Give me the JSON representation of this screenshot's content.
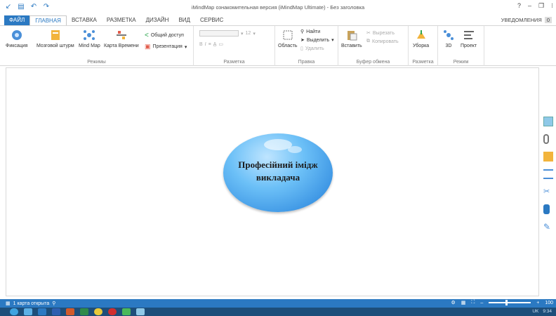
{
  "window": {
    "title": "iMindMap ознакомительная версия (iMindMap Ultimate) - Без заголовка"
  },
  "menu_tabs": [
    {
      "label": "ФАЙЛ"
    },
    {
      "label": "ГЛАВНАЯ"
    },
    {
      "label": "ВСТАВКА"
    },
    {
      "label": "РАЗМЕТКА"
    },
    {
      "label": "ДИЗАЙН"
    },
    {
      "label": "ВИД"
    },
    {
      "label": "СЕРВИС"
    }
  ],
  "notifications": {
    "label": "УВЕДОМЛЕНИЯ",
    "count": "0"
  },
  "ribbon": {
    "modes": {
      "label": "Режимы",
      "buttons": [
        "Фиксация",
        "Мозговой штурм",
        "Mind Map",
        "Карта Времени"
      ],
      "share": "Общий доступ",
      "presentation": "Презентация"
    },
    "layout": {
      "label": "Разметка",
      "font_size": "12"
    },
    "edit": {
      "label": "Правка",
      "area": "Область",
      "find": "Найти",
      "select": "Выделить",
      "delete": "Удалить"
    },
    "clipboard": {
      "label": "Буфер обмена",
      "paste": "Вставить",
      "cut": "Вырезать",
      "copy": "Копировать"
    },
    "layout2": {
      "label": "Разметка",
      "tidy": "Уборка"
    },
    "mode": {
      "label": "Режим",
      "three_d": "3D",
      "project": "Проект"
    }
  },
  "map": {
    "central_line1": "Професійний імідж",
    "central_line2": "викладача"
  },
  "status": {
    "open_maps": "1 карта открыта",
    "zoom": "100"
  },
  "taskbar": {
    "lang": "UK",
    "time": "9:34"
  },
  "colors": {
    "accent": "#2b79c2",
    "node": "#4aa6ee",
    "taskbar": "#1d4e7a"
  }
}
